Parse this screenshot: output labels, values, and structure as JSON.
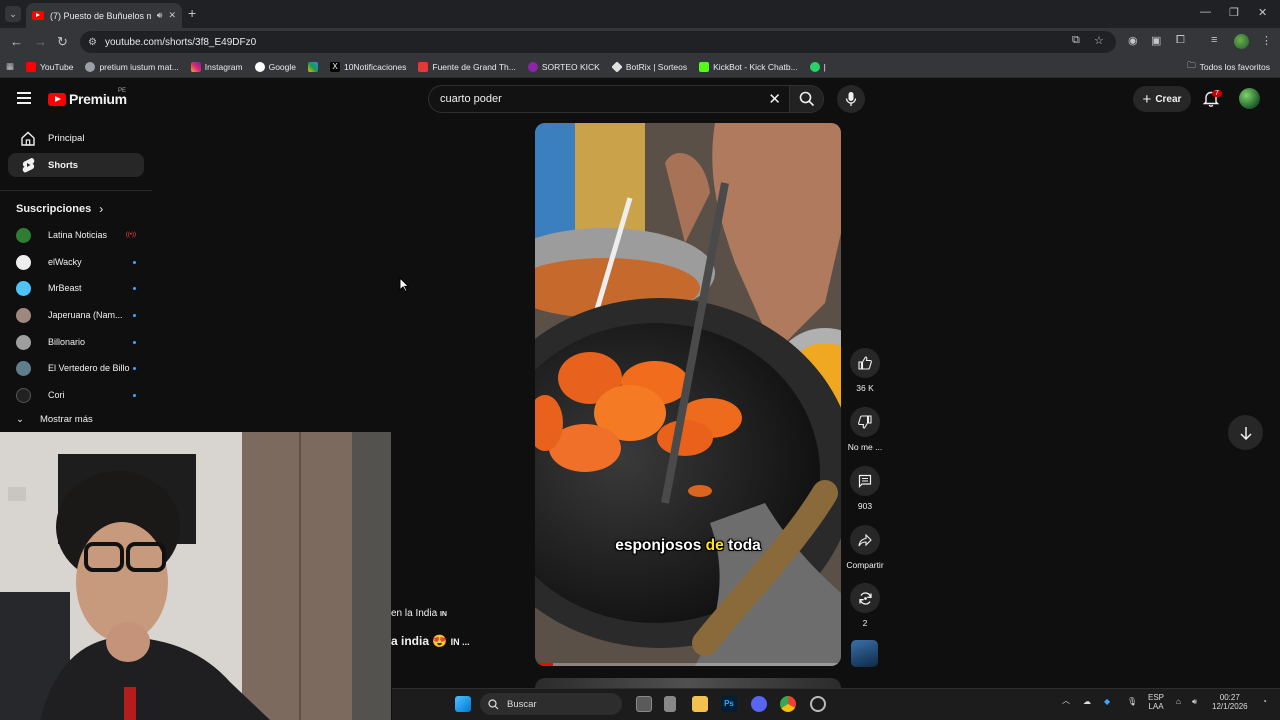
{
  "browser": {
    "tab_title": "(7) Puesto de Buñuelos ma",
    "url": "youtube.com/shorts/3f8_E49DFz0",
    "bookmarks": [
      {
        "label": "YouTube",
        "color": "#ff0000"
      },
      {
        "label": "pretium iustum mat...",
        "color": "#9aa0a6"
      },
      {
        "label": "Instagram",
        "color": "#d62976"
      },
      {
        "label": "Google",
        "color": "#4285f4"
      },
      {
        "label": "",
        "color": "#f4b400"
      },
      {
        "label": "10Notificaciones",
        "color": "#000000"
      },
      {
        "label": "Fuente de Grand Th...",
        "color": "#e53935"
      },
      {
        "label": "SORTEO KICK",
        "color": "#8e24aa"
      },
      {
        "label": "BotRix | Sorteos",
        "color": "#e0e0e0"
      },
      {
        "label": "KickBot - Kick Chatb...",
        "color": "#53fc18"
      },
      {
        "label": "|",
        "color": "#25d366"
      }
    ],
    "all_bookmarks": "Todos los favoritos"
  },
  "youtube": {
    "logo_text": "Premium",
    "logo_badge": "PE",
    "search_value": "cuarto poder",
    "create_label": "Crear",
    "notifications_count": "7",
    "nav": [
      {
        "label": "Principal"
      },
      {
        "label": "Shorts"
      }
    ],
    "subscriptions_title": "Suscripciones",
    "subscriptions": [
      {
        "name": "Latina Noticias",
        "status": "live",
        "color": "#2e7d32"
      },
      {
        "name": "elWacky",
        "status": "new",
        "color": "#eeeeee"
      },
      {
        "name": "MrBeast",
        "status": "new",
        "color": "#4fc3f7"
      },
      {
        "name": "Japeruana (Nam...",
        "status": "new",
        "color": "#a1887f"
      },
      {
        "name": "Billonario",
        "status": "new",
        "color": "#9e9e9e"
      },
      {
        "name": "El Vertedero de Billo",
        "status": "new",
        "color": "#607d8b"
      },
      {
        "name": "Cori",
        "status": "new",
        "color": "#212121"
      }
    ],
    "show_more": "Mostrar más",
    "video": {
      "caption_a": "esponjosos",
      "caption_b": "de",
      "caption_c": "toda",
      "title_line1": "en la India",
      "title_line1_flag": "IN",
      "title_line2": "a india",
      "title_line2_tail": "IN ...",
      "progress": 0.06
    },
    "actions": {
      "likes": "36 K",
      "dislike": "No me ...",
      "comments": "903",
      "share": "Compartir",
      "remix": "2"
    }
  },
  "taskbar": {
    "search_placeholder": "Buscar",
    "lang_top": "ESP",
    "lang_bottom": "LAA",
    "time": "00:27",
    "date": "12/1/2026"
  }
}
